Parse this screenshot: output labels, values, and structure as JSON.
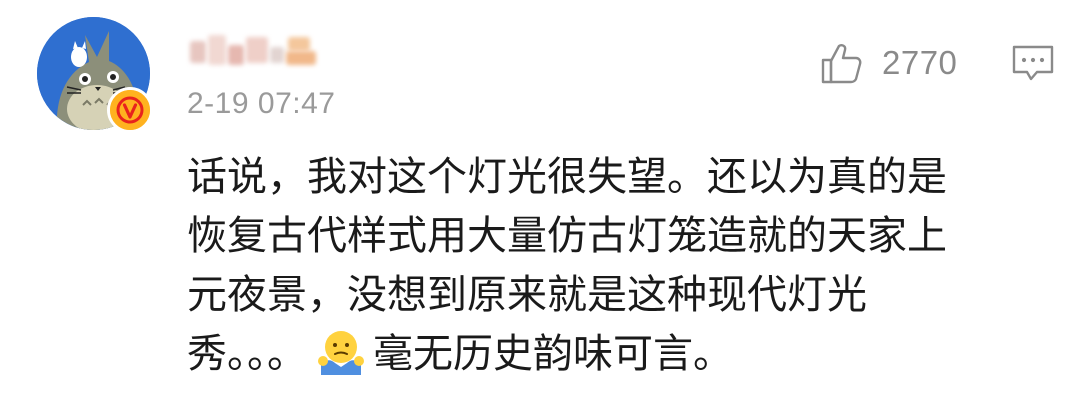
{
  "comment": {
    "timestamp": "2-19 07:47",
    "like_count": "2770",
    "body": {
      "line1": "话说，我对这个灯光很失望。还以为真的是",
      "line2": "恢复古代样式用大量仿古灯笼造就的天家上",
      "line3": "元夜景，没想到原来就是这种现代灯光",
      "line4_before_emoji": "秀。。。",
      "line4_after_emoji": "毫无历史韵味可言。"
    },
    "emoji": "shrug-emoji-icon",
    "badge": "verified-v-icon",
    "colors": {
      "avatar_bg": "#2f6fd0",
      "badge": "#ffb21f",
      "badge_ring": "#e8231d",
      "meta_text": "#9a9a9a",
      "body_text": "#1a1a1a"
    }
  }
}
